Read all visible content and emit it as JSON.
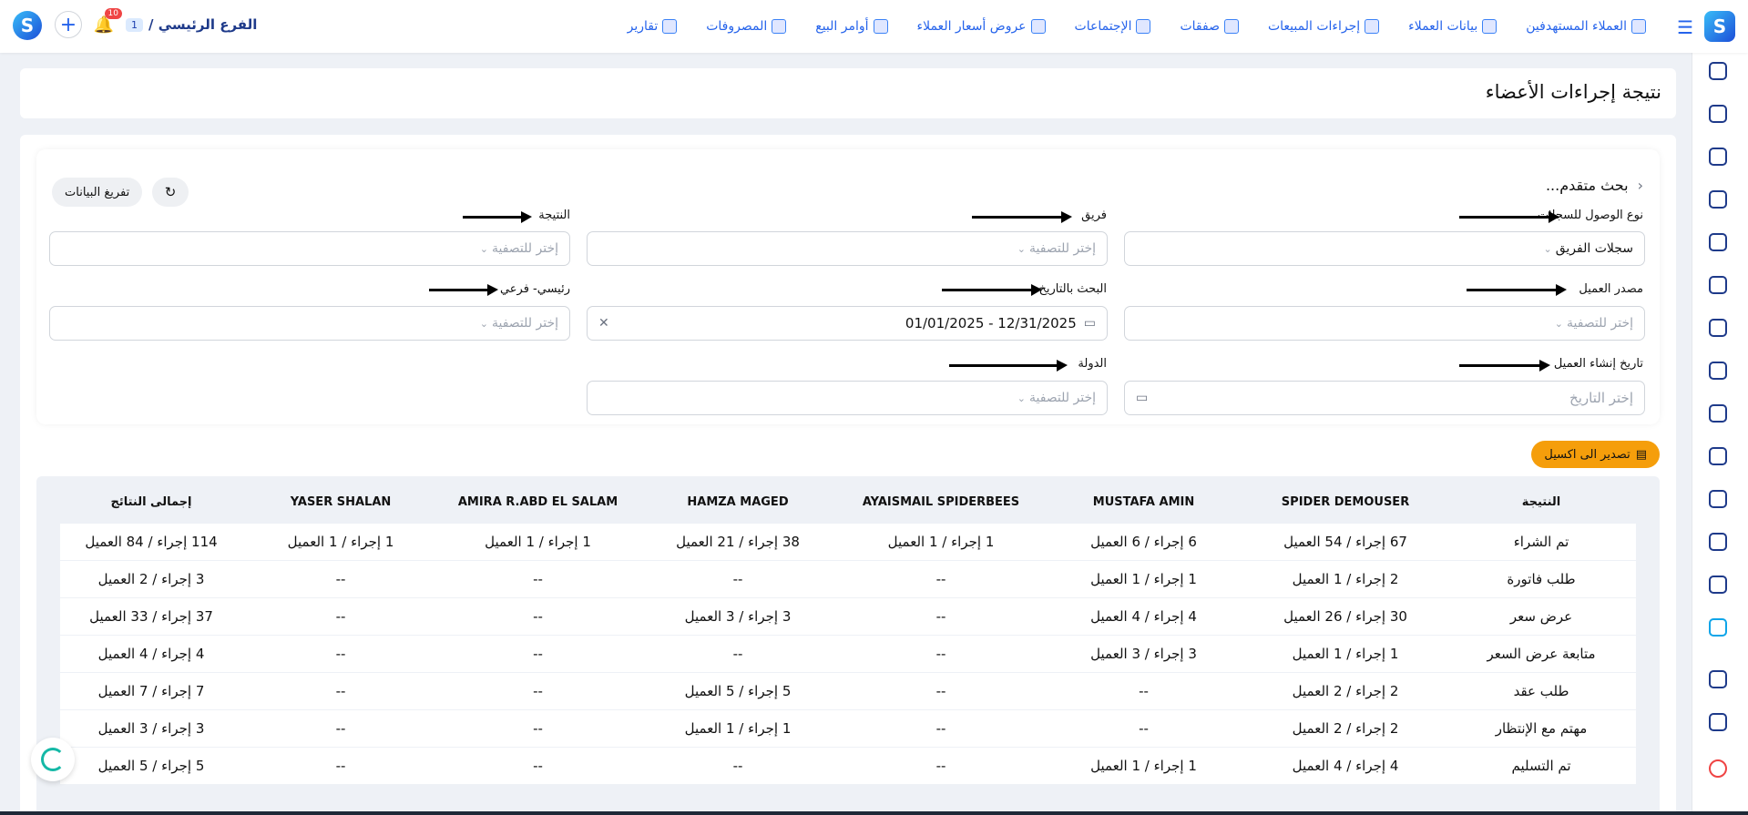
{
  "nav": {
    "items": [
      {
        "label": "العملاء المستهدفين",
        "icon": "target-users-icon"
      },
      {
        "label": "بيانات العملاء",
        "icon": "customer-data-icon"
      },
      {
        "label": "إجراءات المبيعات",
        "icon": "sales-actions-icon"
      },
      {
        "label": "صفقات",
        "icon": "deals-icon"
      },
      {
        "label": "الإجتماعات",
        "icon": "meetings-icon"
      },
      {
        "label": "عروض أسعار العملاء",
        "icon": "quotes-icon"
      },
      {
        "label": "أوامر البيع",
        "icon": "sales-orders-icon"
      },
      {
        "label": "المصروفات",
        "icon": "expenses-icon"
      },
      {
        "label": "تقارير",
        "icon": "reports-icon"
      }
    ],
    "branch_label": "الفرع الرئيسي /",
    "branch_num": "1",
    "notification_count": "10"
  },
  "page": {
    "title": "نتيجة إجراءات الأعضاء"
  },
  "search": {
    "title": "بحث متقدم...",
    "clear_label": "تفريغ البيانات",
    "export_label": "تصدير الى اكسيل",
    "fields": {
      "access": {
        "label": "نوع الوصول للسجلات",
        "value": "سجلات الفريق"
      },
      "team": {
        "label": "فريق",
        "placeholder": "إختر للتصفية"
      },
      "result": {
        "label": "النتيجة",
        "placeholder": "إختر للتصفية"
      },
      "source": {
        "label": "مصدر العميل",
        "placeholder": "إختر للتصفية"
      },
      "date": {
        "label": "البحث بالتاريخ",
        "value": "01/01/2025 - 12/31/2025"
      },
      "mainsub": {
        "label": "رئيسي- فرعي",
        "placeholder": "إختر للتصفية"
      },
      "created": {
        "label": "تاريخ إنشاء العميل",
        "placeholder": "إختر التاريخ"
      },
      "country": {
        "label": "الدولة",
        "placeholder": "إختر للتصفية"
      }
    }
  },
  "table": {
    "headers": [
      "النتيجة",
      "SPIDER DEMOUSER",
      "MUSTAFA AMIN",
      "AYAISMAIL SPIDERBEES",
      "HAMZA MAGED",
      "AMIRA R.ABD EL SALAM",
      "YASER SHALAN",
      "إجمالى النتائج"
    ],
    "rows": [
      [
        "تم الشراء",
        "67 إجراء / 54 العميل",
        "6 إجراء / 6 العميل",
        "1 إجراء / 1 العميل",
        "38 إجراء / 21 العميل",
        "1 إجراء / 1 العميل",
        "1 إجراء / 1 العميل",
        "114 إجراء / 84 العميل"
      ],
      [
        "طلب فاتورة",
        "2 إجراء / 1 العميل",
        "1 إجراء / 1 العميل",
        "--",
        "--",
        "--",
        "--",
        "3 إجراء / 2 العميل"
      ],
      [
        "عرض سعر",
        "30 إجراء / 26 العميل",
        "4 إجراء / 4 العميل",
        "--",
        "3 إجراء / 3 العميل",
        "--",
        "--",
        "37 إجراء / 33 العميل"
      ],
      [
        "متابعة عرض السعر",
        "1 إجراء / 1 العميل",
        "3 إجراء / 3 العميل",
        "--",
        "--",
        "--",
        "--",
        "4 إجراء / 4 العميل"
      ],
      [
        "طلب عقد",
        "2 إجراء / 2 العميل",
        "--",
        "--",
        "5 إجراء / 5 العميل",
        "--",
        "--",
        "7 إجراء / 7 العميل"
      ],
      [
        "مهتم مع الإنتظار",
        "2 إجراء / 2 العميل",
        "--",
        "--",
        "1 إجراء / 1 العميل",
        "--",
        "--",
        "3 إجراء / 3 العميل"
      ],
      [
        "تم التسليم",
        "4 إجراء / 4 العميل",
        "1 إجراء / 1 العميل",
        "--",
        "--",
        "--",
        "--",
        "5 إجراء / 5 العميل"
      ]
    ]
  },
  "colors": {
    "accent": "#2563eb",
    "export": "#f59e0b",
    "loader": "#14b8a6"
  }
}
